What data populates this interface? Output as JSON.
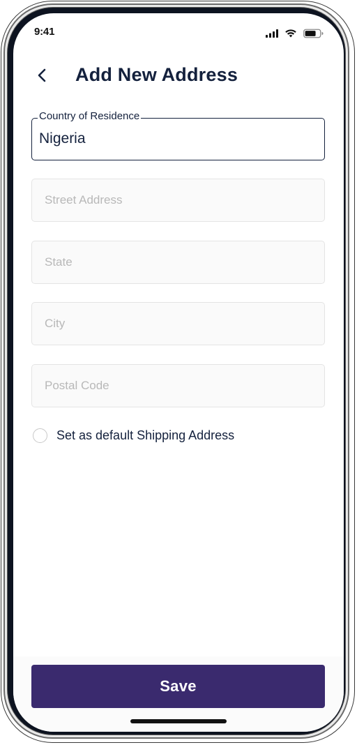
{
  "status_bar": {
    "time": "9:41",
    "icons": [
      "signal-icon",
      "wifi-icon",
      "battery-icon"
    ]
  },
  "header": {
    "back_icon": "chevron-left-icon",
    "title": "Add New Address"
  },
  "form": {
    "country": {
      "label": "Country of Residence",
      "value": "Nigeria"
    },
    "street": {
      "placeholder": "Street Address",
      "value": ""
    },
    "state": {
      "placeholder": "State",
      "value": ""
    },
    "city": {
      "placeholder": "City",
      "value": ""
    },
    "postal": {
      "placeholder": "Postal Code",
      "value": ""
    },
    "default_shipping": {
      "label": "Set as default Shipping Address",
      "checked": false
    }
  },
  "footer": {
    "save_label": "Save"
  },
  "colors": {
    "primary_text": "#14213d",
    "save_button": "#3a2a6e",
    "placeholder": "#b8b8b8"
  }
}
